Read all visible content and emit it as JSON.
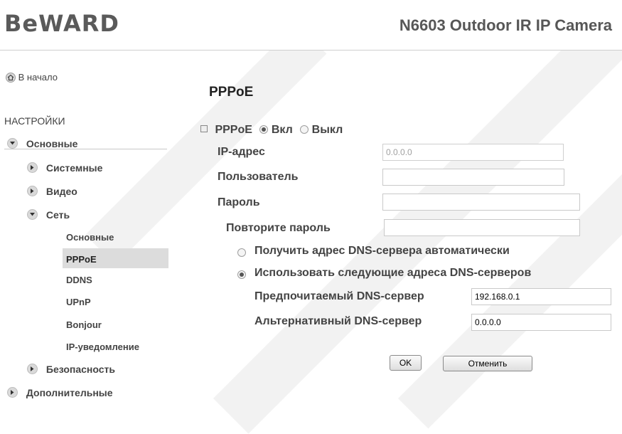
{
  "header": {
    "logo_text": "BeWARD",
    "camera_title": "N6603 Outdoor IR IP Camera"
  },
  "sidebar": {
    "home_label": "В начало",
    "settings_heading": "НАСТРОЙКИ",
    "items": [
      {
        "label": "Основные",
        "expanded": true
      },
      {
        "label": "Системные",
        "expanded": false
      },
      {
        "label": "Видео",
        "expanded": false
      },
      {
        "label": "Сеть",
        "expanded": true
      },
      {
        "label": "Основные"
      },
      {
        "label": "PPPoE",
        "active": true
      },
      {
        "label": "DDNS"
      },
      {
        "label": "UPnP"
      },
      {
        "label": "Bonjour"
      },
      {
        "label": "IP-уведомление"
      },
      {
        "label": "Безопасность",
        "expanded": false
      },
      {
        "label": "Дополнительные",
        "expanded": false
      }
    ]
  },
  "main": {
    "section_title": "PPPoE",
    "pppoe_label": "PPPoE",
    "on_label": "Вкл",
    "off_label": "Выкл",
    "pppoe_enabled": true,
    "ip_label": "IP-адрес",
    "ip_value": "0.0.0.0",
    "user_label": "Пользователь",
    "user_value": "",
    "password_label": "Пароль",
    "password_value": "",
    "repeat_password_label": "Повторите пароль",
    "repeat_password_value": "",
    "dns_auto_label": "Получить адрес DNS-сервера автоматически",
    "dns_manual_label": "Использовать следующие адреса DNS-серверов",
    "dns_mode": "manual",
    "preferred_dns_label": "Предпочитаемый DNS-сервер",
    "preferred_dns_value": "192.168.0.1",
    "alternate_dns_label": "Альтернативный DNS-сервер",
    "alternate_dns_value": "0.0.0.0",
    "ok_label": "OK",
    "cancel_label": "Отменить"
  },
  "colors": {
    "text": "#444444",
    "active_bg": "#dcdcdc",
    "header_text": "#575757"
  }
}
